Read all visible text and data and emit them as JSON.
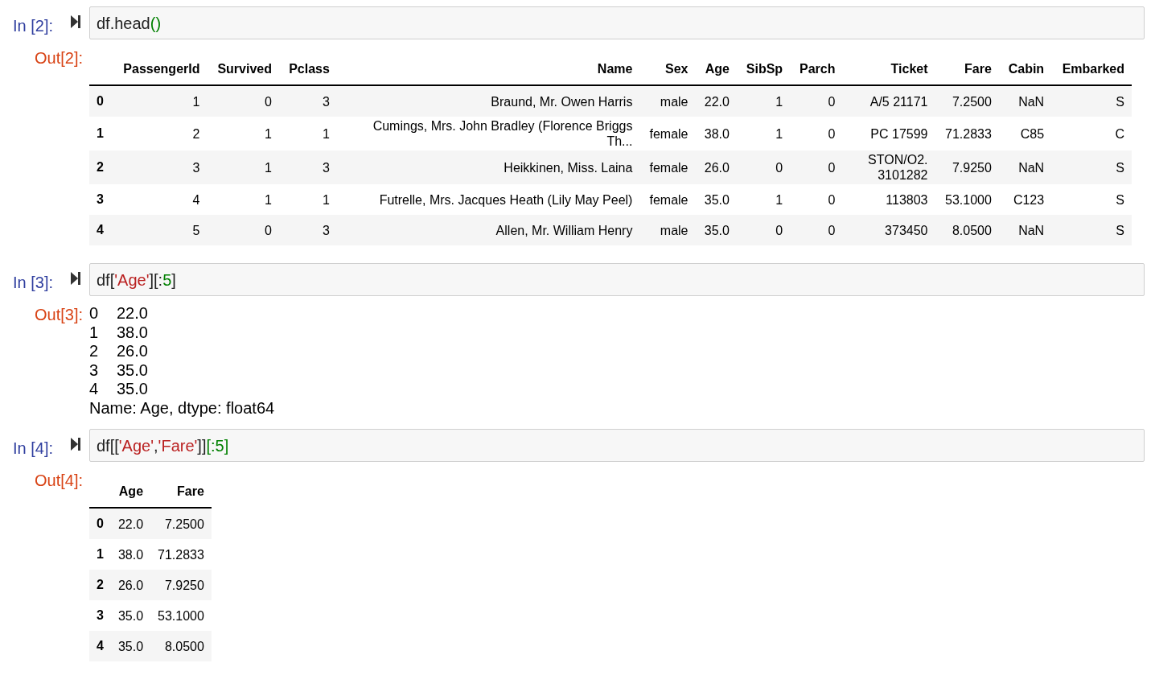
{
  "cells": [
    {
      "input_prompt": "In [2]:",
      "code": [
        {
          "kind": "plain",
          "text": "df.head"
        },
        {
          "kind": "paren",
          "text": "()"
        }
      ],
      "output_prompt": "Out[2]:",
      "output": {
        "kind": "table",
        "columns": [
          "PassengerId",
          "Survived",
          "Pclass",
          "Name",
          "Sex",
          "Age",
          "SibSp",
          "Parch",
          "Ticket",
          "Fare",
          "Cabin",
          "Embarked"
        ],
        "rows": [
          {
            "index": "0",
            "cells": [
              "1",
              "0",
              "3",
              "Braund, Mr. Owen Harris",
              "male",
              "22.0",
              "1",
              "0",
              "A/5 21171",
              "7.2500",
              "NaN",
              "S"
            ]
          },
          {
            "index": "1",
            "cells": [
              "2",
              "1",
              "1",
              "Cumings, Mrs. John Bradley (Florence Briggs Th...",
              "female",
              "38.0",
              "1",
              "0",
              "PC 17599",
              "71.2833",
              "C85",
              "C"
            ]
          },
          {
            "index": "2",
            "cells": [
              "3",
              "1",
              "3",
              "Heikkinen, Miss. Laina",
              "female",
              "26.0",
              "0",
              "0",
              "STON/O2. 3101282",
              "7.9250",
              "NaN",
              "S"
            ]
          },
          {
            "index": "3",
            "cells": [
              "4",
              "1",
              "1",
              "Futrelle, Mrs. Jacques Heath (Lily May Peel)",
              "female",
              "35.0",
              "1",
              "0",
              "113803",
              "53.1000",
              "C123",
              "S"
            ]
          },
          {
            "index": "4",
            "cells": [
              "5",
              "0",
              "3",
              "Allen, Mr. William Henry",
              "male",
              "35.0",
              "0",
              "0",
              "373450",
              "8.0500",
              "NaN",
              "S"
            ]
          }
        ]
      }
    },
    {
      "input_prompt": "In [3]:",
      "code": [
        {
          "kind": "plain",
          "text": "df["
        },
        {
          "kind": "string",
          "text": "'Age'"
        },
        {
          "kind": "plain",
          "text": "][:"
        },
        {
          "kind": "number",
          "text": "5"
        },
        {
          "kind": "plain",
          "text": "]"
        }
      ],
      "output_prompt": "Out[3]:",
      "output": {
        "kind": "text",
        "lines": [
          {
            "index": "0",
            "value": "22.0"
          },
          {
            "index": "1",
            "value": "38.0"
          },
          {
            "index": "2",
            "value": "26.0"
          },
          {
            "index": "3",
            "value": "35.0"
          },
          {
            "index": "4",
            "value": "35.0"
          }
        ],
        "footer": "Name: Age, dtype: float64"
      }
    },
    {
      "input_prompt": "In [4]:",
      "code": [
        {
          "kind": "plain",
          "text": "df[["
        },
        {
          "kind": "string",
          "text": "'Age'"
        },
        {
          "kind": "plain",
          "text": ","
        },
        {
          "kind": "string",
          "text": "'Fare'"
        },
        {
          "kind": "plain",
          "text": "]]"
        },
        {
          "kind": "number",
          "text": "[:5]"
        }
      ],
      "output_prompt": "Out[4]:",
      "output": {
        "kind": "table",
        "columns": [
          "Age",
          "Fare"
        ],
        "rows": [
          {
            "index": "0",
            "cells": [
              "22.0",
              "7.2500"
            ]
          },
          {
            "index": "1",
            "cells": [
              "38.0",
              "71.2833"
            ]
          },
          {
            "index": "2",
            "cells": [
              "26.0",
              "7.9250"
            ]
          },
          {
            "index": "3",
            "cells": [
              "35.0",
              "53.1000"
            ]
          },
          {
            "index": "4",
            "cells": [
              "35.0",
              "8.0500"
            ]
          }
        ]
      }
    }
  ]
}
